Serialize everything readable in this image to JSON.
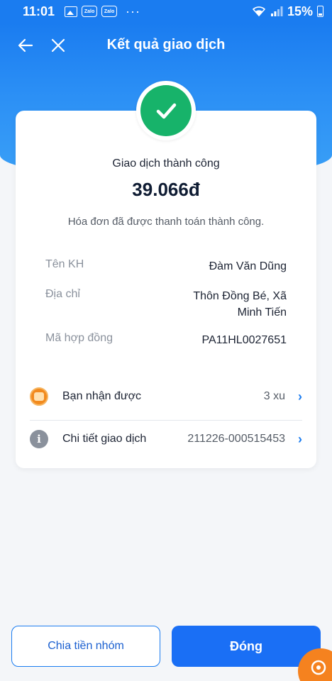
{
  "status_bar": {
    "time": "11:01",
    "notif_icons": [
      "image-icon",
      "zalo-icon",
      "zalo-icon"
    ],
    "zalo_label": "Zalo",
    "more": "···",
    "battery": "15%"
  },
  "header": {
    "title": "Kết quả giao dịch"
  },
  "result": {
    "status": "Giao dịch thành công",
    "amount": "39.066đ",
    "description": "Hóa đơn đã được thanh toán thành công."
  },
  "details": [
    {
      "label": "Tên KH",
      "value": "Đàm Văn Dũng"
    },
    {
      "label": "Địa chỉ",
      "value": "Thôn Đồng Bé, Xã Minh Tiến"
    },
    {
      "label": "Mã hợp đồng",
      "value": "PA11HL0027651"
    }
  ],
  "reward": {
    "label": "Bạn nhận được",
    "value": "3 xu"
  },
  "transaction": {
    "label": "Chi tiết giao dịch",
    "value": "211226-000515453"
  },
  "buttons": {
    "split": "Chia tiền nhóm",
    "close": "Đóng"
  },
  "colors": {
    "primary": "#1a6ff5",
    "success": "#17b36a",
    "accent": "#f5821f"
  }
}
